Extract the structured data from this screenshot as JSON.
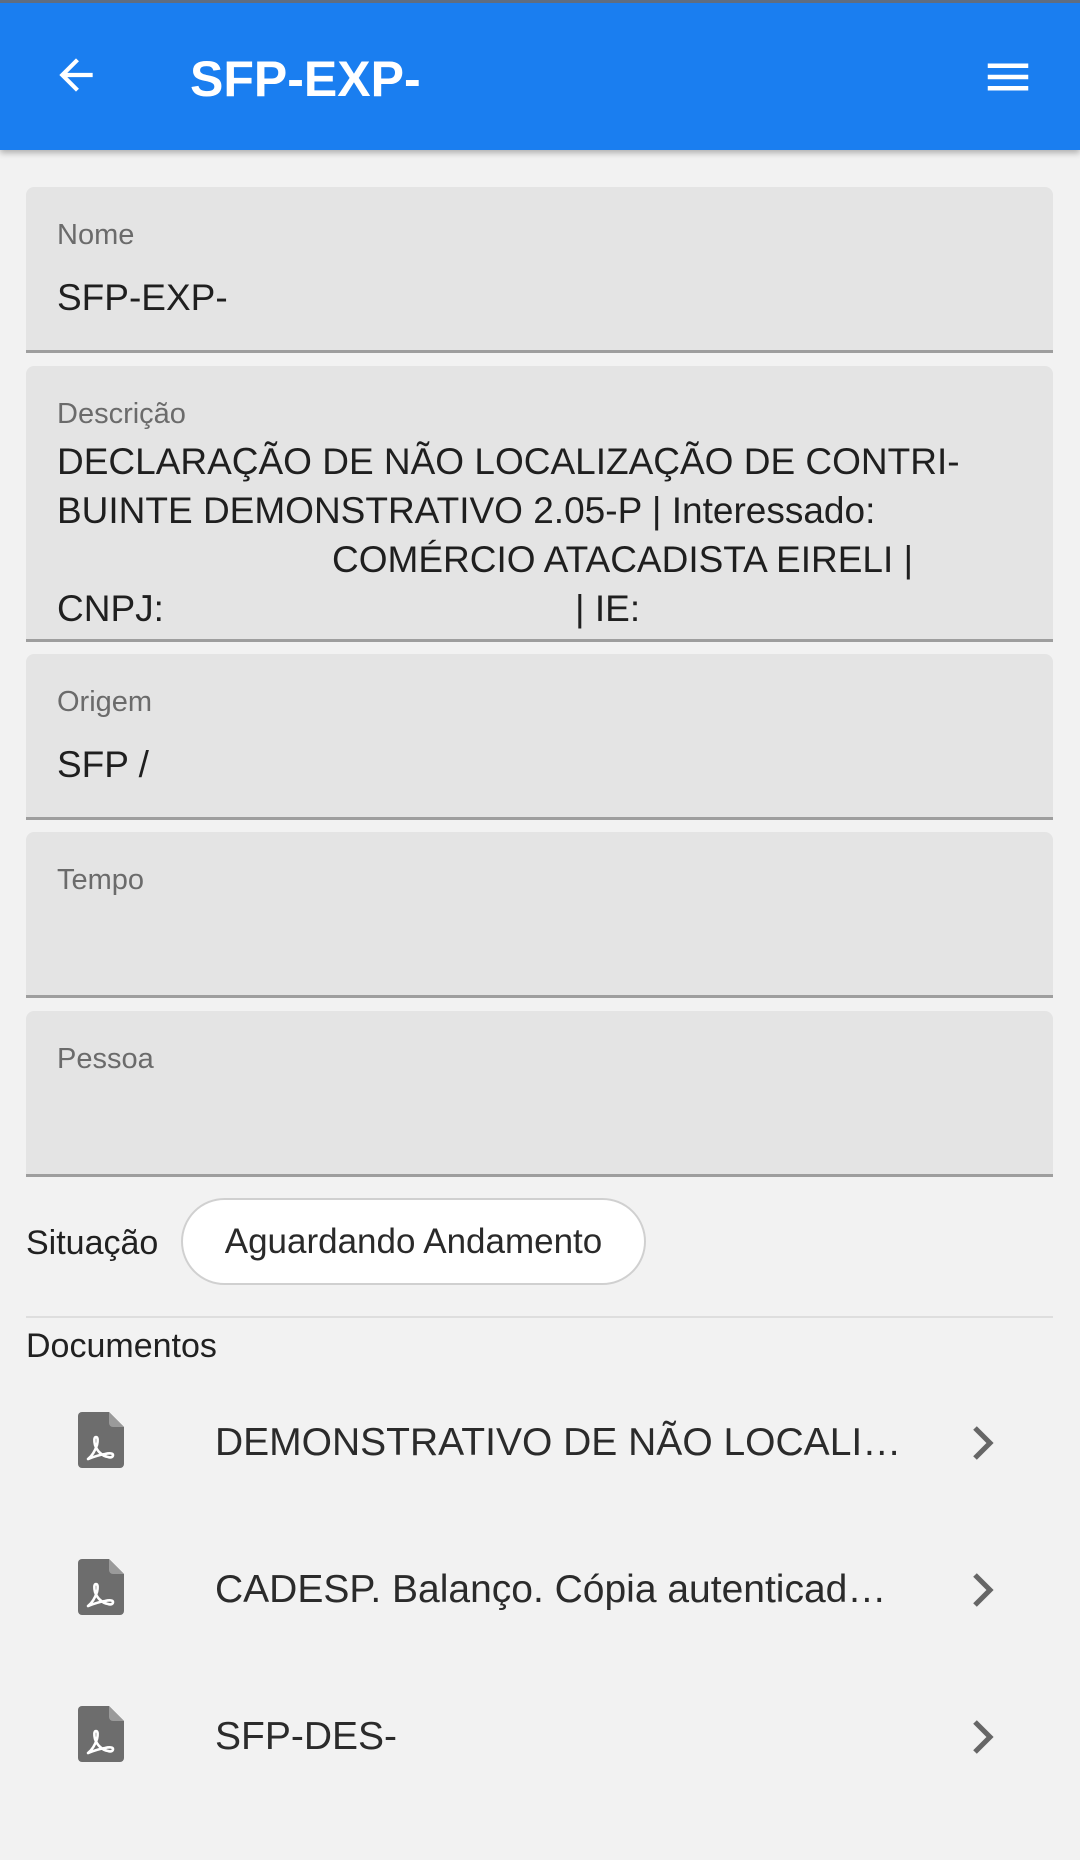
{
  "header": {
    "title": "SFP-EXP-",
    "back_icon": "arrow-left-icon",
    "menu_icon": "hamburger-menu-icon",
    "color": "#1a7ef0"
  },
  "fields": {
    "nome": {
      "label": "Nome",
      "value": "SFP-EXP-"
    },
    "descricao": {
      "label": "Descrição",
      "lines": [
        "DECLARAÇÃO DE NÃO LOCALIZAÇÃO DE CONTRI-",
        "BUINTE DEMONSTRATIVO 2.05-P | Interessado:",
        "COMÉRCIO ATACADISTA EIRELI |",
        "CNPJ:",
        "| IE:"
      ]
    },
    "origem": {
      "label": "Origem",
      "value": "SFP /"
    },
    "tempo": {
      "label": "Tempo",
      "value": ""
    },
    "pessoa": {
      "label": "Pessoa",
      "value": ""
    }
  },
  "situacao": {
    "label": "Situação",
    "value": "Aguardando Andamento"
  },
  "documentos": {
    "header": "Documentos",
    "items": [
      {
        "label": "DEMONSTRATIVO DE NÃO LOCALI…",
        "icon": "pdf-file-icon"
      },
      {
        "label": "CADESP. Balanço. Cópia autenticad…",
        "icon": "pdf-file-icon"
      },
      {
        "label": "SFP-DES-",
        "icon": "pdf-file-icon"
      }
    ]
  }
}
